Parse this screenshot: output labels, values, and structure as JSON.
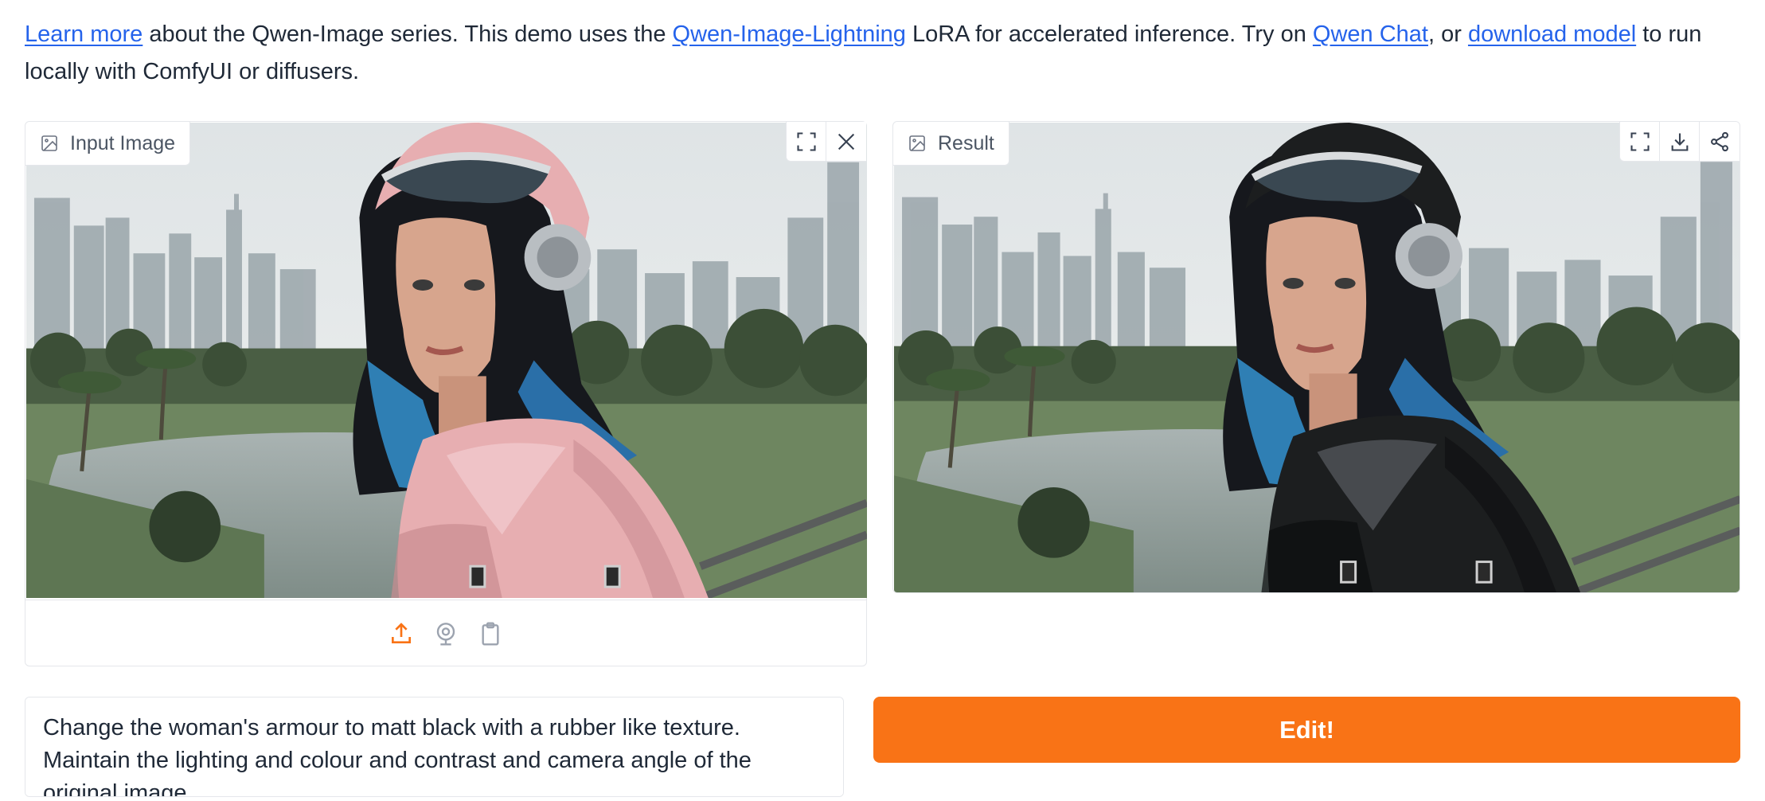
{
  "intro": {
    "link_learn_more": "Learn more",
    "text_1": " about the Qwen-Image series. This demo uses the ",
    "link_lightning": "Qwen-Image-Lightning",
    "text_2": " LoRA for accelerated inference. Try on ",
    "link_chat": "Qwen Chat",
    "text_3": ", or ",
    "link_download": "download model",
    "text_4": " to run locally with ComfyUI or diffusers."
  },
  "input_panel": {
    "label": "Input Image",
    "label_icon": "image-icon",
    "tools": [
      "fullscreen-icon",
      "close-icon"
    ],
    "sources": [
      "upload-icon",
      "webcam-icon",
      "clipboard-icon"
    ],
    "active_source": "upload",
    "armour_color": "#e7aeb1"
  },
  "result_panel": {
    "label": "Result",
    "label_icon": "image-icon",
    "tools": [
      "fullscreen-icon",
      "download-icon",
      "share-icon"
    ],
    "armour_color": "#1c1e1f"
  },
  "prompt": {
    "value": "Change the woman's armour to matt black with a rubber like texture. Maintain the lighting and colour and contrast and camera angle of the original image."
  },
  "edit_button": {
    "label": "Edit!"
  },
  "colors": {
    "accent": "#f97316",
    "link": "#2563eb",
    "border": "#e5e7eb"
  }
}
